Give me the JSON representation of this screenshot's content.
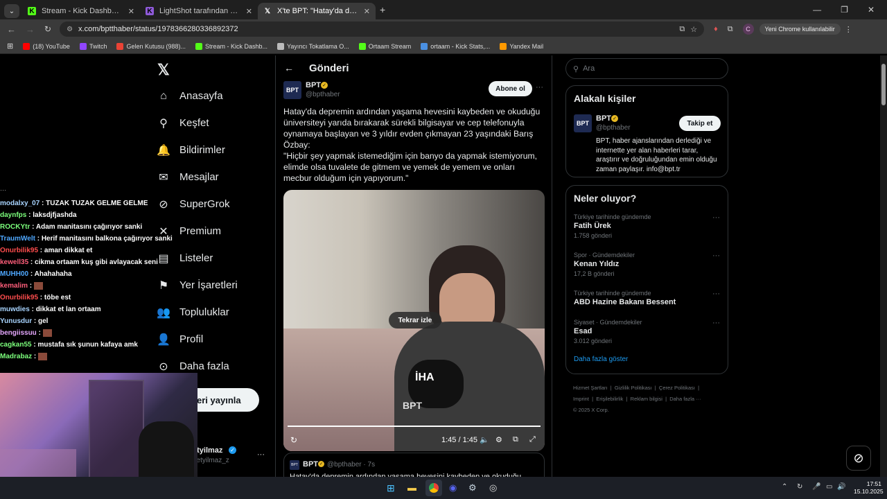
{
  "browser": {
    "tabs": [
      {
        "title": "Stream - Kick Dashboard",
        "icon": "kick-icon",
        "color": "#53fc18",
        "active": false
      },
      {
        "title": "LightShot tarafından Ekran Görü",
        "icon": "lightshot-icon",
        "color": "#8e5ad8",
        "active": false
      },
      {
        "title": "X'te BPT: \"Hatay'da depremin a",
        "icon": "x-icon",
        "color": "#ffffff",
        "active": true
      }
    ],
    "new_tab": "+",
    "url": "x.com/bptthaber/status/1978366280336892372",
    "profile_initial": "C",
    "chrome_notice": "Yeni Chrome kullanılabilir",
    "bookmarks": [
      {
        "label": "(18) YouTube",
        "color": "#ff0000"
      },
      {
        "label": "Twitch",
        "color": "#9146ff"
      },
      {
        "label": "Gelen Kutusu (988)...",
        "color": "#ea4335"
      },
      {
        "label": "Stream - Kick Dashb...",
        "color": "#53fc18"
      },
      {
        "label": "Yayıncı Tokatlama O...",
        "color": "#bbbbbb"
      },
      {
        "label": "Ortaam Stream",
        "color": "#53fc18"
      },
      {
        "label": "ortaam - Kick Stats,...",
        "color": "#4a90e2"
      },
      {
        "label": "Yandex Mail",
        "color": "#ff9900"
      }
    ]
  },
  "nav": {
    "items": [
      {
        "label": "Anasayfa",
        "icon": "home-icon",
        "glyph": "⌂"
      },
      {
        "label": "Keşfet",
        "icon": "search-icon",
        "glyph": "⚲"
      },
      {
        "label": "Bildirimler",
        "icon": "bell-icon",
        "glyph": "🔔"
      },
      {
        "label": "Mesajlar",
        "icon": "mail-icon",
        "glyph": "✉"
      },
      {
        "label": "SuperGrok",
        "icon": "grok-icon",
        "glyph": "⊘"
      },
      {
        "label": "Premium",
        "icon": "x-premium-icon",
        "glyph": "✕"
      },
      {
        "label": "Listeler",
        "icon": "list-icon",
        "glyph": "▤"
      },
      {
        "label": "Yer İşaretleri",
        "icon": "bookmark-icon",
        "glyph": "⚑"
      },
      {
        "label": "Topluluklar",
        "icon": "community-icon",
        "glyph": "👥"
      },
      {
        "label": "Profil",
        "icon": "profile-icon",
        "glyph": "👤"
      },
      {
        "label": "Daha fazla",
        "icon": "more-circle-icon",
        "glyph": "⊙"
      }
    ],
    "post_button": "eri yayınla",
    "account_name": "etyilmaz",
    "account_handle": "netyilmaz_z"
  },
  "chat": [
    {
      "user": "modalxy_07",
      "color": "#a8d4ff",
      "msg": "TUZAK TUZAK GELME GELME"
    },
    {
      "user": "daynfps",
      "color": "#7cff7c",
      "msg": "laksdjfjashda"
    },
    {
      "user": "ROCKYtr",
      "color": "#7cff7c",
      "msg": "Adam manitasını çağırıyor sanki"
    },
    {
      "user": "TraumWelt",
      "color": "#4fa8ff",
      "msg": "Herif manitasını balkona çağırıyor sanki mk"
    },
    {
      "user": "Onurbilik95",
      "color": "#ff4d4d",
      "msg": "aman dikkat et"
    },
    {
      "user": "kewell35",
      "color": "#ff5e7a",
      "msg": "cikma ortaam kuş gibi avlayacak seni"
    },
    {
      "user": "MUHH00",
      "color": "#4fa8ff",
      "msg": "Ahahahaha"
    },
    {
      "user": "kemalim",
      "color": "#ff5e7a",
      "msg": ""
    },
    {
      "user": "Onurbilik95",
      "color": "#ff4d4d",
      "msg": "töbe est"
    },
    {
      "user": "muwdies",
      "color": "#a8d4ff",
      "msg": "dikkat et lan ortaam"
    },
    {
      "user": "Yunusdur",
      "color": "#a8d4ff",
      "msg": "gel"
    },
    {
      "user": "bengiissuu",
      "color": "#e6a8ff",
      "msg": ""
    },
    {
      "user": "cagkan55",
      "color": "#7cff7c",
      "msg": "mustafa sık şunun kafaya amk"
    },
    {
      "user": "Madrabaz",
      "color": "#7cff7c",
      "msg": ""
    }
  ],
  "post": {
    "header": "Gönderi",
    "author": "BPT",
    "handle": "@bpthaber",
    "subscribe": "Abone ol",
    "text1": "Hatay'da depremin ardından yaşama hevesini kaybeden ve okuduğu üniversiteyi yarıda bırakarak sürekli bilgisayar ve cep telefonuyla oynamaya başlayan ve 3 yıldır evden çıkmayan 23 yaşındaki Barış Özbay:",
    "text2": "\"Hiçbir şey yapmak istemediğim için banyo da yapmak istemiyorum, elimde olsa tuvalete de gitmem ve yemek de yemem ve onları mecbur olduğum için yapıyorum.\"",
    "replay": "Tekrar izle",
    "time": "1:45 / 1:45",
    "progress": 1.0,
    "watermark": "İHA",
    "quote_author": "BPT",
    "quote_handle": "@bpthaber · 7s",
    "quote_text": "Hatay'da depremin ardından yaşama hevesini kaybeden ve okuduğu"
  },
  "side": {
    "search_placeholder": "Ara",
    "related_title": "Alakalı kişiler",
    "related_name": "BPT",
    "related_handle": "@bpthaber",
    "follow": "Takip et",
    "related_bio": "BPT, haber ajanslarından derlediği ve internette yer alan haberleri tarar, araştırır ve doğruluğundan emin olduğu zaman paylaşır. info@bpt.tr",
    "trends_title": "Neler oluyor?",
    "trends": [
      {
        "meta": "Türkiye tarihinde gündemde",
        "name": "Fatih Ürek",
        "count": "1.758 gönderi"
      },
      {
        "meta": "Spor · Gündemdekiler",
        "name": "Kenan Yıldız",
        "count": "17,2 B gönderi"
      },
      {
        "meta": "Türkiye tarihinde gündemde",
        "name": "ABD Hazine Bakanı Bessent",
        "count": ""
      },
      {
        "meta": "Siyaset · Gündemdekiler",
        "name": "Esad",
        "count": "3.012 gönderi"
      }
    ],
    "show_more": "Daha fazla göster",
    "footer1": "Hizmet Şartları  |  Gizlilik Politikası  |  Çerez Politikası  |",
    "footer2": "Imprint  |  Erişilebilirlik  |  Reklam bilgisi  |  Daha fazla ···",
    "footer3": "© 2025 X Corp."
  },
  "taskbar": {
    "time": "17:51",
    "date": "15.10.2025"
  }
}
